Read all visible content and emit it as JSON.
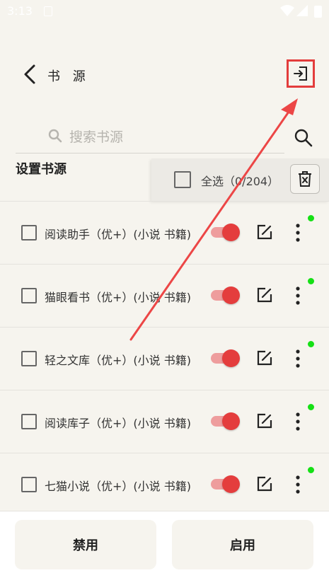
{
  "status_bar": {
    "time": "3:13"
  },
  "toolbar": {
    "title": "书 源",
    "back_icon": "chevron-left-icon",
    "import_icon": "import-icon"
  },
  "search": {
    "placeholder": "搜索书源",
    "icon": "search-icon"
  },
  "section": {
    "title": "设置书源"
  },
  "selection": {
    "select_all_label": "全选（0/204）",
    "delete_icon": "delete-icon"
  },
  "sources": [
    {
      "name": "阅读助手（优+）(小说 书籍)",
      "enabled": true,
      "status_dot": true
    },
    {
      "name": "猫眼看书（优+）(小说 书籍)",
      "enabled": true,
      "status_dot": true
    },
    {
      "name": "轻之文库（优+）(小说 书籍)",
      "enabled": true,
      "status_dot": true
    },
    {
      "name": "阅读库子（优+）(小说 书籍)",
      "enabled": true,
      "status_dot": true
    },
    {
      "name": "七猫小说（优+）(小说 书籍)",
      "enabled": true,
      "status_dot": true
    }
  ],
  "actions": {
    "disable_label": "禁用",
    "enable_label": "启用"
  },
  "colors": {
    "accent": "#e43d3d",
    "highlight": "#e33c3c",
    "status_dot": "#15e015",
    "background": "#f6f4ee"
  }
}
